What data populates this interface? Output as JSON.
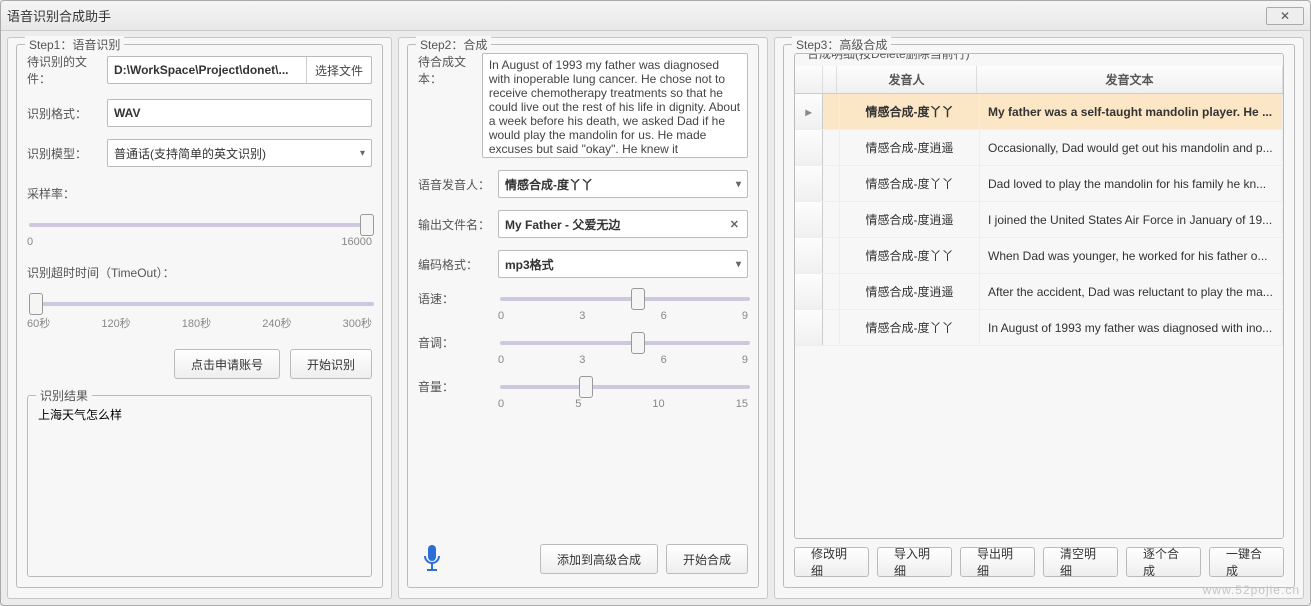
{
  "window": {
    "title": "语音识别合成助手"
  },
  "step1": {
    "title": "Step1：语音识别",
    "file_label": "待识别的文件：",
    "file_value": "D:\\WorkSpace\\Project\\donet\\...",
    "file_browse": "选择文件",
    "format_label": "识别格式：",
    "format_value": "WAV",
    "model_label": "识别模型：",
    "model_value": "普通话(支持简单的英文识别)",
    "rate_label": "采样率：",
    "rate_min": "0",
    "rate_max": "16000",
    "rate_value": 16000,
    "timeout_label": "识别超时时间（TimeOut）：",
    "timeout_ticks": [
      "60秒",
      "120秒",
      "180秒",
      "240秒",
      "300秒"
    ],
    "timeout_value": 60,
    "apply_btn": "点击申请账号",
    "start_btn": "开始识别",
    "result_title": "识别结果",
    "result_text": "上海天气怎么样"
  },
  "step2": {
    "title": "Step2：合成",
    "text_label": "待合成文本：",
    "text_value": "In August of 1993 my father was diagnosed with inoperable lung cancer. He chose not to receive chemotherapy treatments so that he could live out the rest of his life in dignity. About a week before his death, we asked Dad if he would play the mandolin for us. He made excuses but said \"okay\". He knew it",
    "voice_label": "语音发音人：",
    "voice_value": "情感合成-度丫丫",
    "outfile_label": "输出文件名：",
    "outfile_value": "My Father - 父爱无边",
    "enc_label": "编码格式：",
    "enc_value": "mp3格式",
    "speed_label": "语速：",
    "pitch_label": "音调：",
    "volume_label": "音量：",
    "ticks0369": [
      "0",
      "3",
      "6",
      "9"
    ],
    "ticks051015": [
      "0",
      "5",
      "10",
      "15"
    ],
    "speed_value": 5,
    "pitch_value": 5,
    "volume_value": 5,
    "add_btn": "添加到高级合成",
    "start_btn": "开始合成"
  },
  "step3": {
    "title": "Step3：高级合成",
    "table_title": "合成明细(按Delete删除当前行)",
    "col_voice": "发音人",
    "col_text": "发音文本",
    "rows": [
      {
        "voice": "情感合成-度丫丫",
        "text": "My father was a self-taught mandolin player. He ..."
      },
      {
        "voice": "情感合成-度逍遥",
        "text": "Occasionally, Dad would get out his mandolin and p..."
      },
      {
        "voice": "情感合成-度丫丫",
        "text": "Dad loved to play the mandolin for his family he kn..."
      },
      {
        "voice": "情感合成-度逍遥",
        "text": "I joined the United States Air Force in January of 19..."
      },
      {
        "voice": "情感合成-度丫丫",
        "text": "When Dad was younger, he worked for his father o..."
      },
      {
        "voice": "情感合成-度逍遥",
        "text": "After the accident, Dad was reluctant to play the ma..."
      },
      {
        "voice": "情感合成-度丫丫",
        "text": "In August of 1993 my father was diagnosed with ino..."
      }
    ],
    "btn_modify": "修改明细",
    "btn_import": "导入明细",
    "btn_export": "导出明细",
    "btn_clear": "清空明细",
    "btn_each": "逐个合成",
    "btn_merge": "一键合成"
  },
  "watermark": "www.52pojie.cn"
}
